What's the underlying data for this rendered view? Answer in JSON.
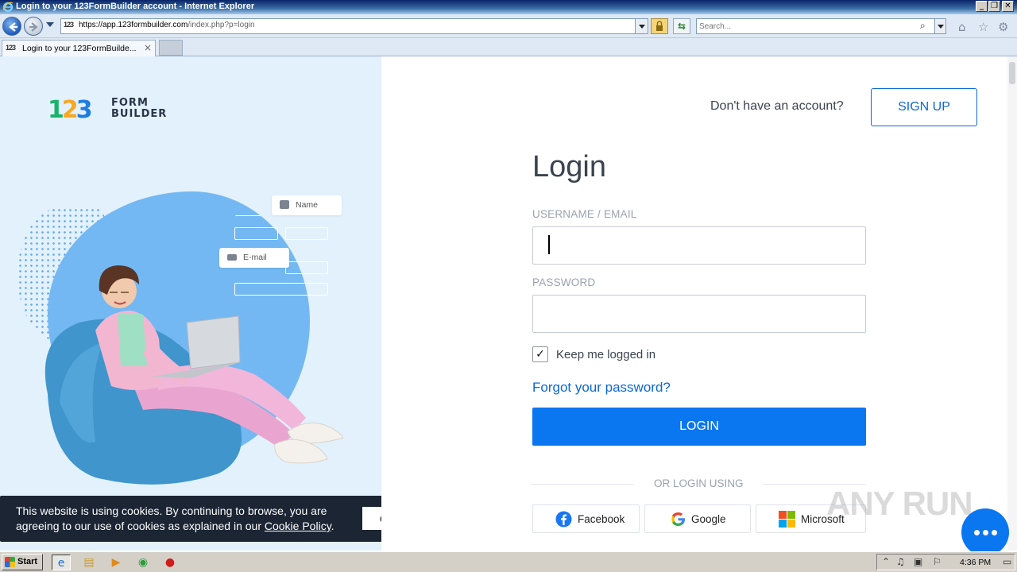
{
  "window": {
    "title": "Login to your 123FormBuilder account - Internet Explorer",
    "minimize": "_",
    "restore": "❐",
    "close": "✕"
  },
  "browser": {
    "url_scheme": "https://",
    "url_host": "app.123formbuilder.com",
    "url_path": "/index.php?p=login",
    "search_placeholder": "Search...",
    "tab_title": "Login to your 123FormBuilde...",
    "tab_favicon": "123",
    "tab_close": "×"
  },
  "hero": {
    "logo_digits": [
      "1",
      "2",
      "3"
    ],
    "logo_word_1": "FORM",
    "logo_word_2": "BUILDER",
    "card_name": "Name",
    "card_email": "E-mail"
  },
  "header": {
    "no_account": "Don't have an account?",
    "signup_label": "SIGN UP"
  },
  "login": {
    "title": "Login",
    "username_label": "USERNAME / EMAIL",
    "username_value": "",
    "password_label": "PASSWORD",
    "password_value": "",
    "keep_logged_in": "Keep me logged in",
    "keep_logged_in_checked": true,
    "checkmark": "✓",
    "forgot": "Forgot your password?",
    "submit": "LOGIN",
    "or_login_using": "OR LOGIN USING",
    "social": [
      "Facebook",
      "Google",
      "Microsoft"
    ]
  },
  "cookie": {
    "text_before": "This website is using cookies. By continuing to browse, you are agreeing to our use of cookies as explained in our ",
    "link": "Cookie Policy",
    "text_after": ".",
    "ok": "OK"
  },
  "watermark": "ANY RUN",
  "taskbar": {
    "start": "Start",
    "clock": "4:36 PM"
  },
  "colors": {
    "primary": "#0a76f0",
    "link": "#0a69d6",
    "hero_bg": "#e2f1fc",
    "cookie_bg": "#1b2533"
  }
}
